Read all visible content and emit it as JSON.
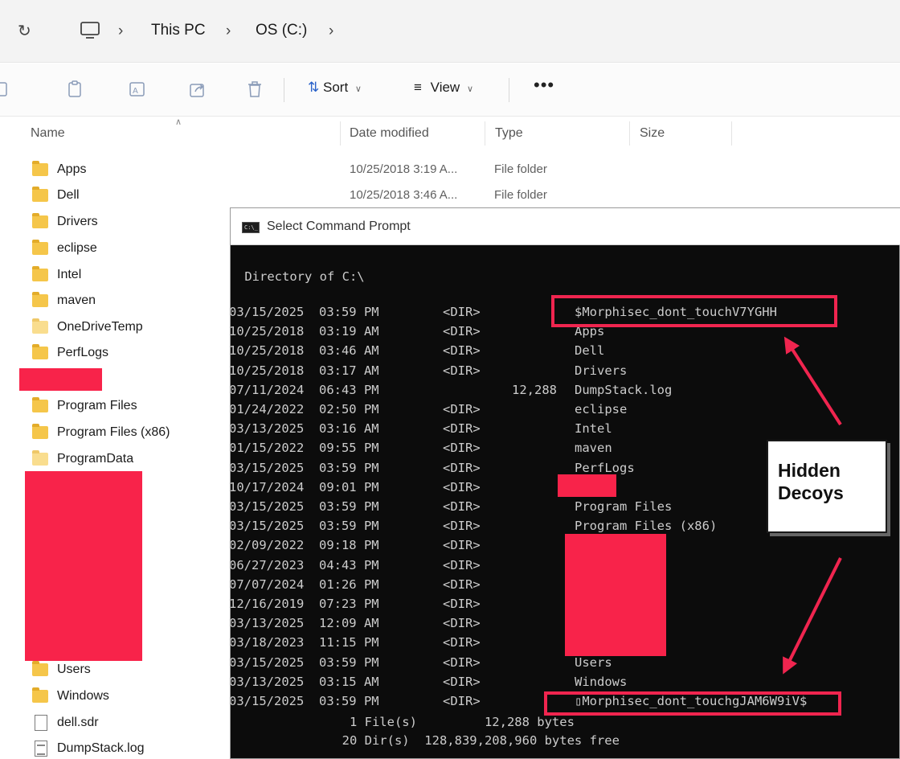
{
  "explorer": {
    "breadcrumbs": [
      "This PC",
      "OS (C:)"
    ],
    "toolbar": {
      "sort_label": "Sort",
      "view_label": "View",
      "more_label": "•••"
    },
    "columns": {
      "name": "Name",
      "date_modified": "Date modified",
      "type": "Type",
      "size": "Size"
    },
    "rows": [
      {
        "name": "Apps",
        "date": "10/25/2018 3:19 A...",
        "type": "File folder"
      },
      {
        "name": "Dell",
        "date": "10/25/2018 3:46 A...",
        "type": "File folder"
      },
      {
        "name": "Drivers"
      },
      {
        "name": "eclipse"
      },
      {
        "name": "Intel"
      },
      {
        "name": "maven"
      },
      {
        "name": "OneDriveTemp"
      },
      {
        "name": "PerfLogs"
      },
      {
        "name": "Program Files"
      },
      {
        "name": "Program Files (x86)"
      },
      {
        "name": "ProgramData"
      },
      {
        "name": "Users"
      },
      {
        "name": "Windows"
      },
      {
        "name": "dell.sdr"
      },
      {
        "name": "DumpStack.log"
      }
    ]
  },
  "cmd": {
    "title": "Select Command Prompt",
    "icon_text": "C:\\_",
    "directory_line": " Directory of C:\\",
    "listing": [
      {
        "date": "03/15/2025",
        "time": "03:59 PM",
        "kind": "<DIR>",
        "size": "",
        "name": "$Morphisec_dont_touchV7YGHH"
      },
      {
        "date": "10/25/2018",
        "time": "03:19 AM",
        "kind": "<DIR>",
        "size": "",
        "name": "Apps"
      },
      {
        "date": "10/25/2018",
        "time": "03:46 AM",
        "kind": "<DIR>",
        "size": "",
        "name": "Dell"
      },
      {
        "date": "10/25/2018",
        "time": "03:17 AM",
        "kind": "<DIR>",
        "size": "",
        "name": "Drivers"
      },
      {
        "date": "07/11/2024",
        "time": "06:43 PM",
        "kind": "",
        "size": "12,288",
        "name": "DumpStack.log"
      },
      {
        "date": "01/24/2022",
        "time": "02:50 PM",
        "kind": "<DIR>",
        "size": "",
        "name": "eclipse"
      },
      {
        "date": "03/13/2025",
        "time": "03:16 AM",
        "kind": "<DIR>",
        "size": "",
        "name": "Intel"
      },
      {
        "date": "01/15/2022",
        "time": "09:55 PM",
        "kind": "<DIR>",
        "size": "",
        "name": "maven"
      },
      {
        "date": "03/15/2025",
        "time": "03:59 PM",
        "kind": "<DIR>",
        "size": "",
        "name": "PerfLogs"
      },
      {
        "date": "10/17/2024",
        "time": "09:01 PM",
        "kind": "<DIR>",
        "size": "",
        "name": ""
      },
      {
        "date": "03/15/2025",
        "time": "03:59 PM",
        "kind": "<DIR>",
        "size": "",
        "name": "Program Files"
      },
      {
        "date": "03/15/2025",
        "time": "03:59 PM",
        "kind": "<DIR>",
        "size": "",
        "name": "Program Files (x86)"
      },
      {
        "date": "02/09/2022",
        "time": "09:18 PM",
        "kind": "<DIR>",
        "size": "",
        "name": ""
      },
      {
        "date": "06/27/2023",
        "time": "04:43 PM",
        "kind": "<DIR>",
        "size": "",
        "name": ""
      },
      {
        "date": "07/07/2024",
        "time": "01:26 PM",
        "kind": "<DIR>",
        "size": "",
        "name": ""
      },
      {
        "date": "12/16/2019",
        "time": "07:23 PM",
        "kind": "<DIR>",
        "size": "",
        "name": ""
      },
      {
        "date": "03/13/2025",
        "time": "12:09 AM",
        "kind": "<DIR>",
        "size": "",
        "name": ""
      },
      {
        "date": "03/18/2023",
        "time": "11:15 PM",
        "kind": "<DIR>",
        "size": "",
        "name": ""
      },
      {
        "date": "03/15/2025",
        "time": "03:59 PM",
        "kind": "<DIR>",
        "size": "",
        "name": "Users"
      },
      {
        "date": "03/13/2025",
        "time": "03:15 AM",
        "kind": "<DIR>",
        "size": "",
        "name": "Windows"
      },
      {
        "date": "03/15/2025",
        "time": "03:59 PM",
        "kind": "<DIR>",
        "size": "",
        "name": "▯Morphisec_dont_touchgJAM6W9iV$"
      }
    ],
    "summary_files": "               1 File(s)         12,288 bytes",
    "summary_dirs": "              20 Dir(s)  128,839,208,960 bytes free"
  },
  "annotation": {
    "callout_line1": "Hidden",
    "callout_line2": "Decoys",
    "accent_color": "#f0254f",
    "redaction_color": "#f8234a"
  }
}
